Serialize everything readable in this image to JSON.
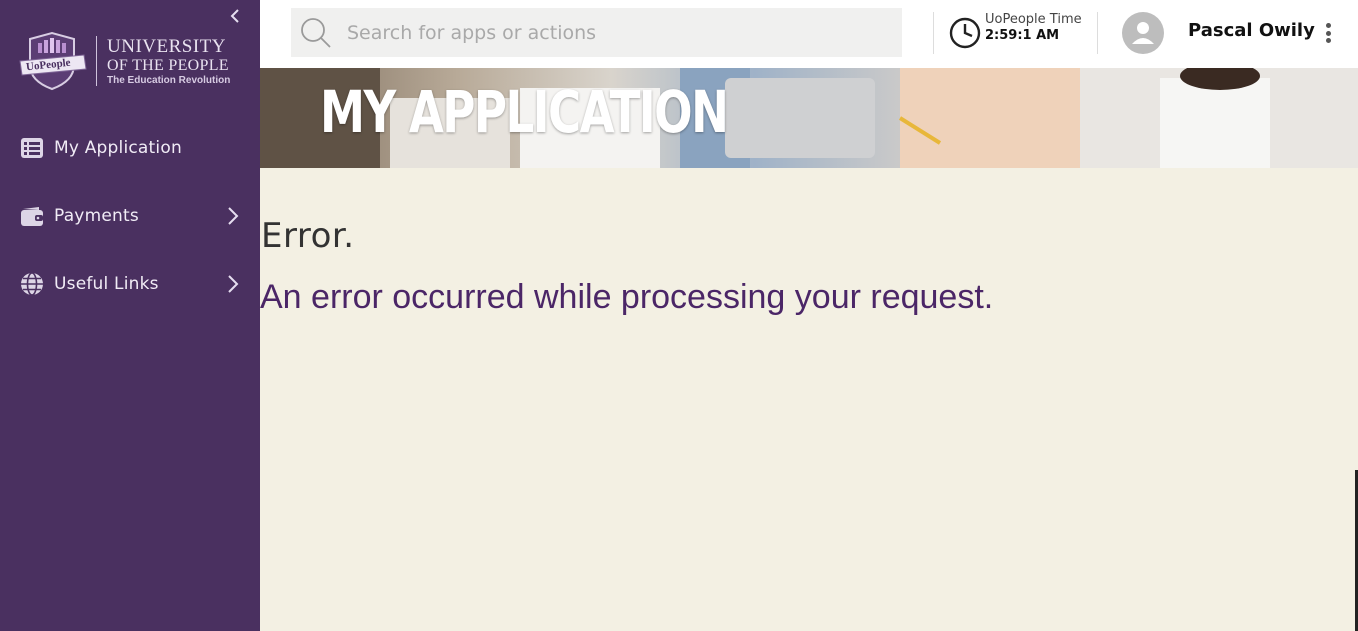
{
  "sidebar": {
    "logo": {
      "seal_text": "UoPeople",
      "line1": "UNIVERSITY",
      "line2": "OF THE PEOPLE",
      "line3": "The Education Revolution"
    },
    "items": [
      {
        "label": "My Application",
        "icon": "list-icon",
        "expandable": false
      },
      {
        "label": "Payments",
        "icon": "wallet-icon",
        "expandable": true
      },
      {
        "label": "Useful Links",
        "icon": "globe-icon",
        "expandable": true
      }
    ]
  },
  "header": {
    "search": {
      "placeholder": "Search for apps or actions"
    },
    "time": {
      "label": "UoPeople Time",
      "value": "2:59:1 AM"
    },
    "user": {
      "name": "Pascal Owily"
    }
  },
  "banner": {
    "title": "MY APPLICATION"
  },
  "main": {
    "error_title": "Error.",
    "error_message": "An error occurred while processing your request."
  },
  "colors": {
    "sidebar_bg": "#4a3060",
    "content_bg": "#f3f0e3",
    "error_message": "#4b2667"
  }
}
